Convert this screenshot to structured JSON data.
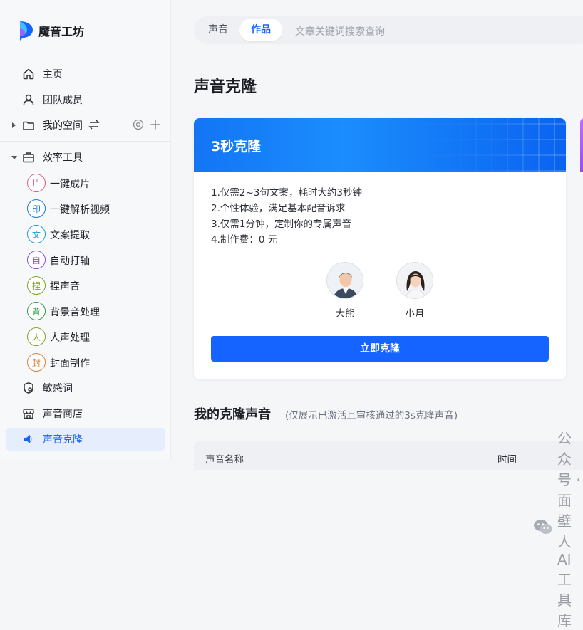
{
  "brand": {
    "name": "魔音工坊"
  },
  "sidebar": {
    "items": [
      {
        "label": "主页",
        "icon": "home-icon"
      },
      {
        "label": "团队成员",
        "icon": "user-icon"
      },
      {
        "label": "我的空间",
        "icon": "folder-icon"
      },
      {
        "label": "效率工具",
        "icon": "briefcase-icon"
      }
    ],
    "tools": [
      {
        "glyph": "片",
        "label": "一键成片",
        "color": "#e05a8a"
      },
      {
        "glyph": "印",
        "label": "一键解析视频",
        "color": "#1a7bd9"
      },
      {
        "glyph": "文",
        "label": "文案提取",
        "color": "#1a9bd9"
      },
      {
        "glyph": "自",
        "label": "自动打轴",
        "color": "#8a4cd9"
      },
      {
        "glyph": "捏",
        "label": "捏声音",
        "color": "#7aa528"
      },
      {
        "glyph": "背",
        "label": "背景音处理",
        "color": "#2e9c4a"
      },
      {
        "glyph": "人",
        "label": "人声处理",
        "color": "#7aa528"
      },
      {
        "glyph": "封",
        "label": "封面制作",
        "color": "#d9823a"
      }
    ],
    "bottom": [
      {
        "label": "敏感词",
        "icon": "shield-icon"
      },
      {
        "label": "声音商店",
        "icon": "store-icon"
      },
      {
        "label": "声音克隆",
        "icon": "mic-icon"
      }
    ]
  },
  "tabs": [
    {
      "label": "声音"
    },
    {
      "label": "作品"
    }
  ],
  "search": {
    "placeholder": "文章关键词搜索查询"
  },
  "page": {
    "title": "声音克隆"
  },
  "card": {
    "title": "3秒克隆",
    "features": [
      "1.仅需2~3句文案，耗时大约3秒钟",
      "2.个性体验，满足基本配音诉求",
      "3.仅需1分钟，定制你的专属声音",
      "4.制作费：0 元"
    ],
    "voices": [
      {
        "name": "大熊"
      },
      {
        "name": "小月"
      }
    ],
    "button": "立即克隆"
  },
  "section": {
    "title": "我的克隆声音",
    "note": "(仅展示已激活且审核通过的3s克隆声音)"
  },
  "table": {
    "columns": [
      "声音名称",
      "时间"
    ]
  },
  "watermark": {
    "text": "公众号 · 面壁人AI工具库"
  },
  "colors": {
    "accent": "#1664ff",
    "active_bg": "#e6edfc"
  }
}
